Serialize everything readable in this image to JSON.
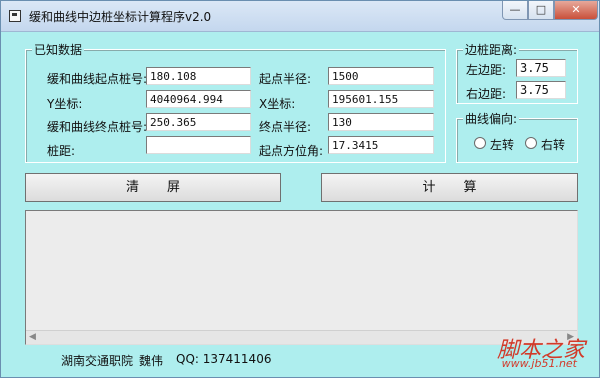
{
  "window": {
    "title": "缓和曲线中边桩坐标计算程序v2.0",
    "controls": {
      "minimize": "—",
      "maximize": "□",
      "close": "✕"
    }
  },
  "known": {
    "legend": "已知数据",
    "start_station_label": "缓和曲线起点桩号:",
    "start_station_value": "180.108",
    "start_radius_label": "起点半径:",
    "start_radius_value": "1500",
    "y_label": "Y坐标:",
    "y_value": "4040964.994",
    "x_label": "X坐标:",
    "x_value": "195601.155",
    "end_station_label": "缓和曲线终点桩号:",
    "end_station_value": "250.365",
    "end_radius_label": "终点半径:",
    "end_radius_value": "130",
    "pile_distance_label": "桩距:",
    "pile_distance_value": "",
    "azimuth_label": "起点方位角:",
    "azimuth_value": "17.3415"
  },
  "offset": {
    "legend": "边桩距离:",
    "left_label": "左边距:",
    "left_value": "3.75",
    "right_label": "右边距:",
    "right_value": "3.75"
  },
  "direction": {
    "legend": "曲线偏向:",
    "left_turn": "左转",
    "right_turn": "右转"
  },
  "buttons": {
    "clear": "清屏",
    "compute": "计算"
  },
  "footer": {
    "org": "湖南交通职院",
    "author": "魏伟",
    "qq": "QQ: 137411406"
  },
  "watermark": {
    "brand": "脚本之家",
    "url": "www.jb51.net"
  }
}
